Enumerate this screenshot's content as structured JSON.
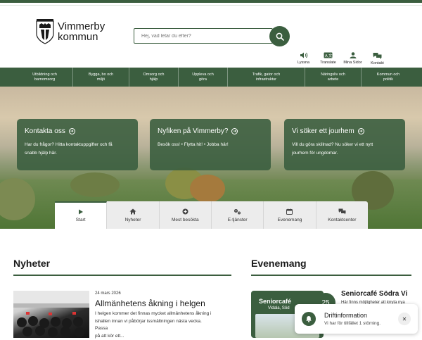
{
  "header": {
    "logo_line1": "Vimmerby",
    "logo_line2": "kommun",
    "search_placeholder": "Hej, vad letar du efter?"
  },
  "tools": [
    {
      "label": "Lyssna",
      "icon": "speaker-icon"
    },
    {
      "label": "Translate",
      "icon": "translate-icon"
    },
    {
      "label": "Mina Sidor",
      "icon": "person-icon"
    },
    {
      "label": "Kontakt",
      "icon": "chat-icon"
    }
  ],
  "nav": [
    {
      "line1": "Utbildning och",
      "line2": "barnomsorg"
    },
    {
      "line1": "Bygga, bo och",
      "line2": "miljö"
    },
    {
      "line1": "Omsorg och",
      "line2": "hjälp"
    },
    {
      "line1": "Uppleva och",
      "line2": "göra"
    },
    {
      "line1": "Trafik, gator och",
      "line2": "infrastruktur"
    },
    {
      "line1": "Näringsliv och",
      "line2": "arbete"
    },
    {
      "line1": "Kommun och",
      "line2": "politik"
    }
  ],
  "cards": [
    {
      "title": "Kontakta oss",
      "line1": "Har du frågor? Hitta kontaktuppgifter och få",
      "line2": "snabb hjälp här."
    },
    {
      "title": "Nyfiken på Vimmerby?",
      "line1": "Besök oss! • Flytta hit! • Jobba här!",
      "line2": ""
    },
    {
      "title": "Vi söker ett jourhem",
      "line1": "Vill du göra skillnad? Nu söker vi ett nytt",
      "line2": "jourhem för ungdomar."
    }
  ],
  "tabs": [
    {
      "label": "Start",
      "icon": "play-icon"
    },
    {
      "label": "Nyheter",
      "icon": "home-icon"
    },
    {
      "label": "Mest besökta",
      "icon": "plus-circle-icon"
    },
    {
      "label": "E-tjänster",
      "icon": "gears-icon"
    },
    {
      "label": "Evenemang",
      "icon": "calendar-icon"
    },
    {
      "label": "Kontaktcenter",
      "icon": "chat-icon"
    }
  ],
  "news": {
    "heading": "Nyheter",
    "date": "24 mars 2026",
    "title": "Allmänhetens åkning i helgen",
    "text1": "I helgen kommer det finnas mycket allmänhetens åkning i",
    "text2": "ishallen innan vi påbörjar issmältningen nästa vecka. Passa",
    "text3": "på att kör ett..."
  },
  "events": {
    "heading": "Evenemang",
    "image_label": "Seniorcafé",
    "image_sub": "Vidala, Söd",
    "date": "25",
    "title": "Seniorcafé Södra Vi",
    "text": "Här finns möjligheter att knyta nya"
  },
  "toast": {
    "title": "Driftinformation",
    "text": "Vi har för tillfället 1 störning.",
    "close": "✕"
  },
  "colors": {
    "brand": "#3b5e3f"
  }
}
